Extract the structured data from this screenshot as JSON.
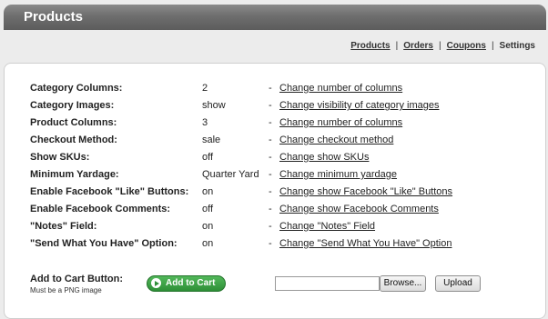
{
  "header": {
    "title": "Products"
  },
  "subnav": {
    "items": [
      {
        "label": "Products"
      },
      {
        "label": "Orders"
      },
      {
        "label": "Coupons"
      },
      {
        "label": "Settings"
      }
    ],
    "separator": "|"
  },
  "settings": [
    {
      "label": "Category Columns:",
      "value": "2",
      "dash": "-",
      "link": "Change number of columns"
    },
    {
      "label": "Category Images:",
      "value": "show",
      "dash": "-",
      "link": "Change visibility of category images"
    },
    {
      "label": "Product Columns:",
      "value": "3",
      "dash": "-",
      "link": "Change number of columns"
    },
    {
      "label": "Checkout Method:",
      "value": "sale",
      "dash": "-",
      "link": "Change checkout method"
    },
    {
      "label": "Show SKUs:",
      "value": "off",
      "dash": "-",
      "link": "Change show SKUs"
    },
    {
      "label": "Minimum Yardage:",
      "value": "Quarter Yard",
      "dash": "-",
      "link": "Change minimum yardage"
    },
    {
      "label": "Enable Facebook \"Like\" Buttons:",
      "value": "on",
      "dash": "-",
      "link": "Change show Facebook \"Like\" Buttons"
    },
    {
      "label": "Enable Facebook Comments:",
      "value": "off",
      "dash": "-",
      "link": "Change show Facebook Comments"
    },
    {
      "label": "\"Notes\" Field:",
      "value": "on",
      "dash": "-",
      "link": "Change \"Notes\" Field"
    },
    {
      "label": "\"Send What You Have\" Option:",
      "value": "on",
      "dash": "-",
      "link": "Change \"Send What You Have\" Option"
    }
  ],
  "cart": {
    "label": "Add to Cart Button:",
    "sublabel": "Must be a PNG image",
    "button_label": "Add to Cart",
    "browse_label": "Browse...",
    "upload_label": "Upload"
  },
  "colors": {
    "header": "#6e6e6e",
    "cart_button": "#2e8f37"
  }
}
